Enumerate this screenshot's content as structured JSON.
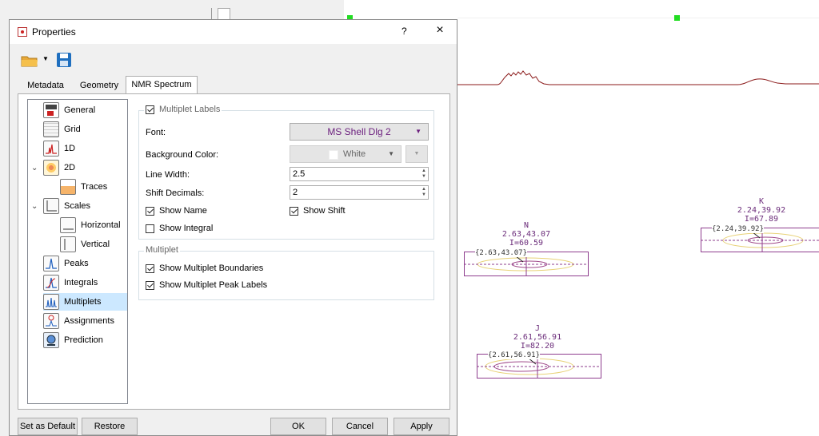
{
  "dialog": {
    "title": "Properties",
    "help": "?",
    "close": "×"
  },
  "tabs": [
    {
      "label": "Metadata"
    },
    {
      "label": "Geometry"
    },
    {
      "label": "NMR Spectrum"
    }
  ],
  "tree": {
    "items": [
      {
        "label": "General",
        "icon": "general-icon"
      },
      {
        "label": "Grid",
        "icon": "grid-icon"
      },
      {
        "label": "1D",
        "icon": "1d-icon"
      },
      {
        "label": "2D",
        "icon": "2d-icon"
      },
      {
        "label": "Traces",
        "icon": "traces-icon"
      },
      {
        "label": "Scales",
        "icon": "scales-icon"
      },
      {
        "label": "Horizontal",
        "icon": "horizontal-icon"
      },
      {
        "label": "Vertical",
        "icon": "vertical-icon"
      },
      {
        "label": "Peaks",
        "icon": "peaks-icon"
      },
      {
        "label": "Integrals",
        "icon": "integrals-icon"
      },
      {
        "label": "Multiplets",
        "icon": "multiplets-icon"
      },
      {
        "label": "Assignments",
        "icon": "assignments-icon"
      },
      {
        "label": "Prediction",
        "icon": "prediction-icon"
      }
    ],
    "selected": "Multiplets"
  },
  "multiplet_labels": {
    "legend": "Multiplet Labels",
    "checked": true,
    "font_label": "Font:",
    "font_value": "MS Shell Dlg 2",
    "bg_label": "Background Color:",
    "bg_value": "White",
    "line_width_label": "Line Width:",
    "line_width_value": "2.5",
    "shift_decimals_label": "Shift Decimals:",
    "shift_decimals_value": "2",
    "show_name": "Show Name",
    "show_shift": "Show Shift",
    "show_integral": "Show Integral"
  },
  "multiplet": {
    "legend": "Multiplet",
    "show_boundaries": "Show Multiplet Boundaries",
    "show_peak_labels": "Show Multiplet Peak Labels"
  },
  "buttons": {
    "set_default": "Set as Default",
    "restore": "Restore",
    "ok": "OK",
    "cancel": "Cancel",
    "apply": "Apply"
  },
  "spectrum": {
    "multiplets": [
      {
        "name": "N",
        "shift": "2.63,43.07",
        "integral": "I=60.59",
        "peak": "{2.63,43.07}"
      },
      {
        "name": "K",
        "shift": "2.24,39.92",
        "integral": "I=67.89",
        "peak": "{2.24,39.92}"
      },
      {
        "name": "J",
        "shift": "2.61,56.91",
        "integral": "I=82.20",
        "peak": "{2.61,56.91}"
      }
    ],
    "colors": {
      "label": "#6b2c7a",
      "trace": "#8b1a1a",
      "marker": "#22dd22"
    }
  }
}
